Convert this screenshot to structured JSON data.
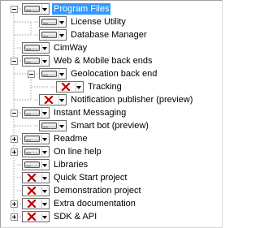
{
  "features": [
    {
      "label": "Program Files",
      "depth": 0,
      "expander": "minus",
      "state": "installed",
      "selected": true
    },
    {
      "label": "License Utility",
      "depth": 1,
      "expander": null,
      "state": "installed",
      "selected": false
    },
    {
      "label": "Database Manager",
      "depth": 1,
      "expander": null,
      "state": "installed",
      "selected": false
    },
    {
      "label": "CimWay",
      "depth": 0,
      "expander": null,
      "state": "installed",
      "selected": false
    },
    {
      "label": "Web & Mobile back ends",
      "depth": 0,
      "expander": "minus",
      "state": "installed",
      "selected": false
    },
    {
      "label": "Geolocation back end",
      "depth": 1,
      "expander": "minus",
      "state": "installed",
      "selected": false
    },
    {
      "label": "Tracking",
      "depth": 2,
      "expander": null,
      "state": "unavailable",
      "selected": false
    },
    {
      "label": "Notification publisher (preview)",
      "depth": 1,
      "expander": null,
      "state": "unavailable",
      "selected": false
    },
    {
      "label": "Instant Messaging",
      "depth": 0,
      "expander": "minus",
      "state": "installed",
      "selected": false
    },
    {
      "label": "Smart bot (preview)",
      "depth": 1,
      "expander": null,
      "state": "installed",
      "selected": false
    },
    {
      "label": "Readme",
      "depth": 0,
      "expander": "plus",
      "state": "installed",
      "selected": false
    },
    {
      "label": "On line help",
      "depth": 0,
      "expander": "plus",
      "state": "installed",
      "selected": false
    },
    {
      "label": "Libraries",
      "depth": 0,
      "expander": null,
      "state": "installed",
      "selected": false
    },
    {
      "label": "Quick Start project",
      "depth": 0,
      "expander": null,
      "state": "unavailable",
      "selected": false
    },
    {
      "label": "Demonstration project",
      "depth": 0,
      "expander": null,
      "state": "unavailable",
      "selected": false
    },
    {
      "label": "Extra documentation",
      "depth": 0,
      "expander": "plus",
      "state": "unavailable",
      "selected": false
    },
    {
      "label": "SDK & API",
      "depth": 0,
      "expander": "plus",
      "state": "unavailable",
      "selected": false
    }
  ],
  "icons": {
    "installed": "hard-drive-icon",
    "unavailable": "red-x-icon",
    "dropdown": "chevron-down-icon"
  },
  "colors": {
    "selection": "#3399ff",
    "unavailable_x": "#c00000",
    "tree_lines": "#a0a0a0"
  }
}
